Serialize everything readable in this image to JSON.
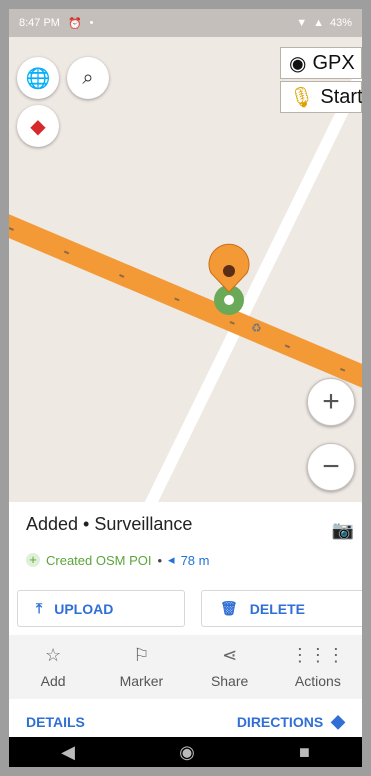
{
  "statusbar": {
    "time": "8:47 PM",
    "battery": "43%"
  },
  "map": {
    "gpx_label": "GPX",
    "start_label": "Start",
    "zoom_in": "+",
    "zoom_out": "−",
    "colors": {
      "road": "#f39a37",
      "path": "#ffffff",
      "background": "#efe9e4",
      "marker": "#f39a37",
      "poi": "#6aa957"
    }
  },
  "panel": {
    "title": "Added • Surveillance",
    "status": "Created OSM POI",
    "separator": "•",
    "distance": "78 m",
    "upload_label": "UPLOAD",
    "delete_label": "DELETE",
    "actions": [
      "Add",
      "Marker",
      "Share",
      "Actions"
    ],
    "details_label": "DETAILS",
    "directions_label": "DIRECTIONS"
  },
  "icons": [
    "globe-icon",
    "search-icon",
    "compass-icon",
    "camera-icon",
    "upload-icon",
    "trash-icon",
    "star-icon",
    "flag-icon",
    "share-icon",
    "grid-icon",
    "directions-icon"
  ]
}
